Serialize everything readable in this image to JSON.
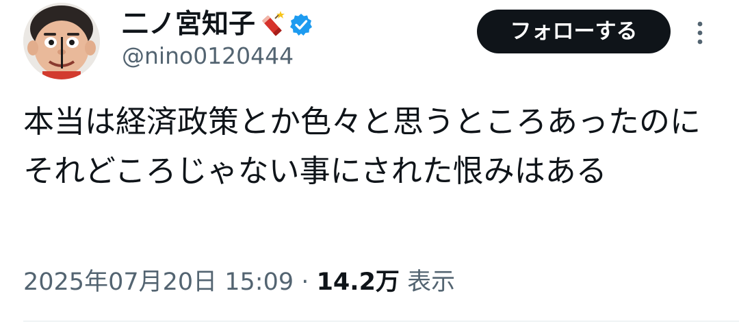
{
  "header": {
    "display_name": "二ノ宮知子",
    "name_emoji": "firecracker-emoji",
    "verified": true,
    "badge_color": "#1d9bf0",
    "handle": "@nino0120444",
    "follow_label": "フォローする",
    "more_icon": "more-vertical-icon"
  },
  "tweet": {
    "text": "本当は経済政策とか色々と思うところあったのにそれどころじゃない事にされた恨みはある",
    "timestamp": "2025年07月20日 15:09",
    "separator": "·",
    "views_count": "14.2万",
    "views_label": "表示"
  },
  "colors": {
    "text_primary": "#0f1419",
    "text_secondary": "#536471",
    "button_bg": "#0f1419",
    "button_text": "#ffffff"
  }
}
